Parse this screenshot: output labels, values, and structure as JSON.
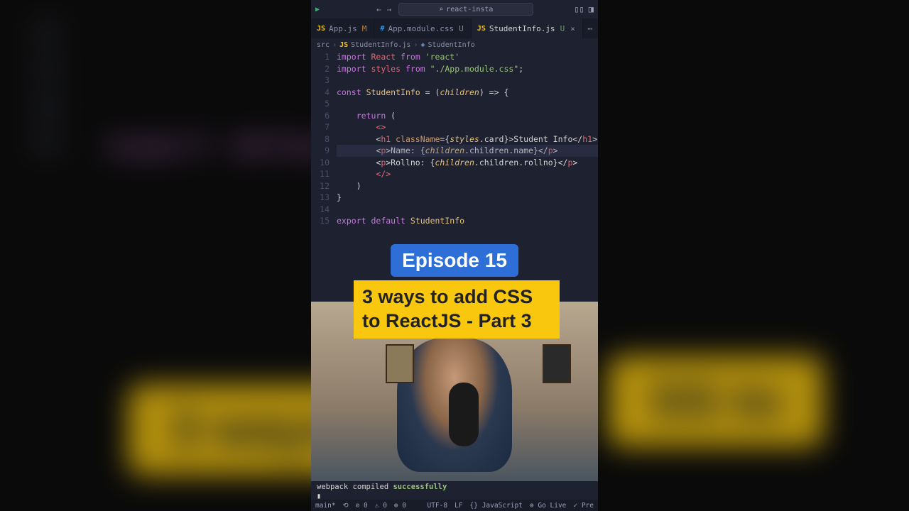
{
  "bg": {
    "gutter_lines": [
      "12",
      "13",
      "14",
      "15"
    ],
    "bg_code": "export default",
    "yellow_left": "3 ways\nReact",
    "yellow_right": "SS to"
  },
  "titlebar": {
    "search_text": "react-insta"
  },
  "tabs": [
    {
      "icon": "JS",
      "icon_type": "js",
      "name": "App.js",
      "mod": "M",
      "u": "",
      "active": false
    },
    {
      "icon": "#",
      "icon_type": "css",
      "name": "App.module.css",
      "mod": "",
      "u": "U",
      "active": false
    },
    {
      "icon": "JS",
      "icon_type": "js",
      "name": "StudentInfo.js",
      "mod": "",
      "u": "U",
      "active": true
    }
  ],
  "breadcrumb": {
    "src": "src",
    "file": "StudentInfo.js",
    "symbol": "StudentInfo"
  },
  "code": {
    "gutter": [
      "1",
      "2",
      "3",
      "4",
      "5",
      "6",
      "7",
      "8",
      "9",
      "10",
      "11",
      "12",
      "13",
      "14",
      "15"
    ],
    "lines": [
      {
        "t": [
          [
            "kw",
            "import"
          ],
          [
            "",
            " "
          ],
          [
            "id",
            "React"
          ],
          [
            "",
            " "
          ],
          [
            "kw",
            "from"
          ],
          [
            "",
            " "
          ],
          [
            "str",
            "'react'"
          ]
        ]
      },
      {
        "t": [
          [
            "kw",
            "import"
          ],
          [
            "",
            " "
          ],
          [
            "id",
            "styles"
          ],
          [
            "",
            " "
          ],
          [
            "kw",
            "from"
          ],
          [
            "",
            " "
          ],
          [
            "str",
            "\"./App.module.css\""
          ],
          [
            "",
            ";"
          ]
        ]
      },
      {
        "t": [
          [
            "",
            ""
          ]
        ]
      },
      {
        "t": [
          [
            "kw",
            "const"
          ],
          [
            "",
            " "
          ],
          [
            "fn",
            "StudentInfo"
          ],
          [
            "",
            " = ("
          ],
          [
            "param",
            "children"
          ],
          [
            "",
            ") => {"
          ]
        ]
      },
      {
        "t": [
          [
            "",
            ""
          ]
        ]
      },
      {
        "t": [
          [
            "",
            "    "
          ],
          [
            "kw",
            "return"
          ],
          [
            "",
            " ("
          ]
        ]
      },
      {
        "t": [
          [
            "",
            "        "
          ],
          [
            "tag",
            "<>"
          ]
        ]
      },
      {
        "t": [
          [
            "",
            "        <"
          ],
          [
            "tag",
            "h1"
          ],
          [
            "",
            " "
          ],
          [
            "attr",
            "className"
          ],
          [
            "",
            "={"
          ],
          [
            "param",
            "styles"
          ],
          [
            "",
            ".card}>Student Info</"
          ],
          [
            "tag",
            "h1"
          ],
          [
            "",
            ">"
          ]
        ]
      },
      {
        "t": [
          [
            "",
            "        <"
          ],
          [
            "tag",
            "p"
          ],
          [
            "",
            ">Name: {"
          ],
          [
            "param",
            "children"
          ],
          [
            "",
            ".children.name}</"
          ],
          [
            "tag",
            "p"
          ],
          [
            "",
            ">"
          ]
        ]
      },
      {
        "t": [
          [
            "",
            "        <"
          ],
          [
            "tag",
            "p"
          ],
          [
            "",
            ">Rollno: {"
          ],
          [
            "param",
            "children"
          ],
          [
            "",
            ".children.rollno}</"
          ],
          [
            "tag",
            "p"
          ],
          [
            "",
            ">"
          ]
        ]
      },
      {
        "t": [
          [
            "",
            "        "
          ],
          [
            "tag",
            "</>"
          ]
        ]
      },
      {
        "t": [
          [
            "",
            "    )"
          ]
        ]
      },
      {
        "t": [
          [
            "",
            "}"
          ]
        ]
      },
      {
        "t": [
          [
            "",
            ""
          ]
        ]
      },
      {
        "t": [
          [
            "kw",
            "export"
          ],
          [
            "",
            " "
          ],
          [
            "kw",
            "default"
          ],
          [
            "",
            " "
          ],
          [
            "fn",
            "StudentInfo"
          ]
        ]
      }
    ]
  },
  "overlays": {
    "episode": "Episode 15",
    "title": "3 ways to add CSS to ReactJS - Part 3"
  },
  "terminal": {
    "prefix": "webpack compiled ",
    "success": "successfully",
    "cursor": "▮"
  },
  "statusbar": {
    "branch": "main*",
    "sync": "⟲",
    "errors": "⊘ 0",
    "warnings": "⚠ 0",
    "port": "⊕ 0",
    "encoding": "UTF-8",
    "eol": "LF",
    "lang": "{} JavaScript",
    "golive": "⊚ Go Live",
    "pre": "✓ Pre"
  }
}
